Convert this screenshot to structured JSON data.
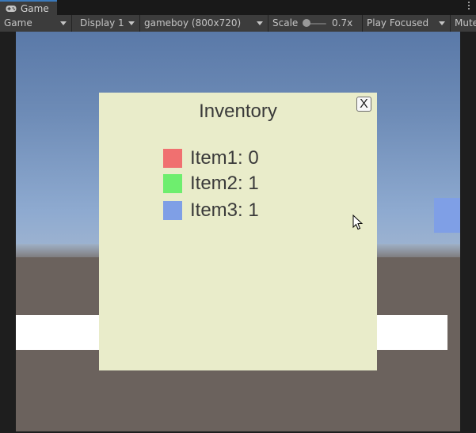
{
  "tab": {
    "title": "Game",
    "icon": "gamepad-icon"
  },
  "toolbar": {
    "game_dropdown": "Game",
    "display_dropdown": "Display 1",
    "resolution_dropdown": "gameboy (800x720)",
    "scale_label": "Scale",
    "scale_value": "0.7x",
    "play_mode_dropdown": "Play Focused",
    "mute_label": "Mute"
  },
  "inventory": {
    "title": "Inventory",
    "close_label": "X",
    "items": [
      {
        "label": "Item1: 0",
        "color": "#f07070"
      },
      {
        "label": "Item2: 1",
        "color": "#6eee6e"
      },
      {
        "label": "Item3: 1",
        "color": "#7f9fe6"
      }
    ]
  },
  "colors": {
    "panel": "#e9ecca",
    "accent_tab": "#3a79bb",
    "blue_cube": "#7f9fe6"
  }
}
